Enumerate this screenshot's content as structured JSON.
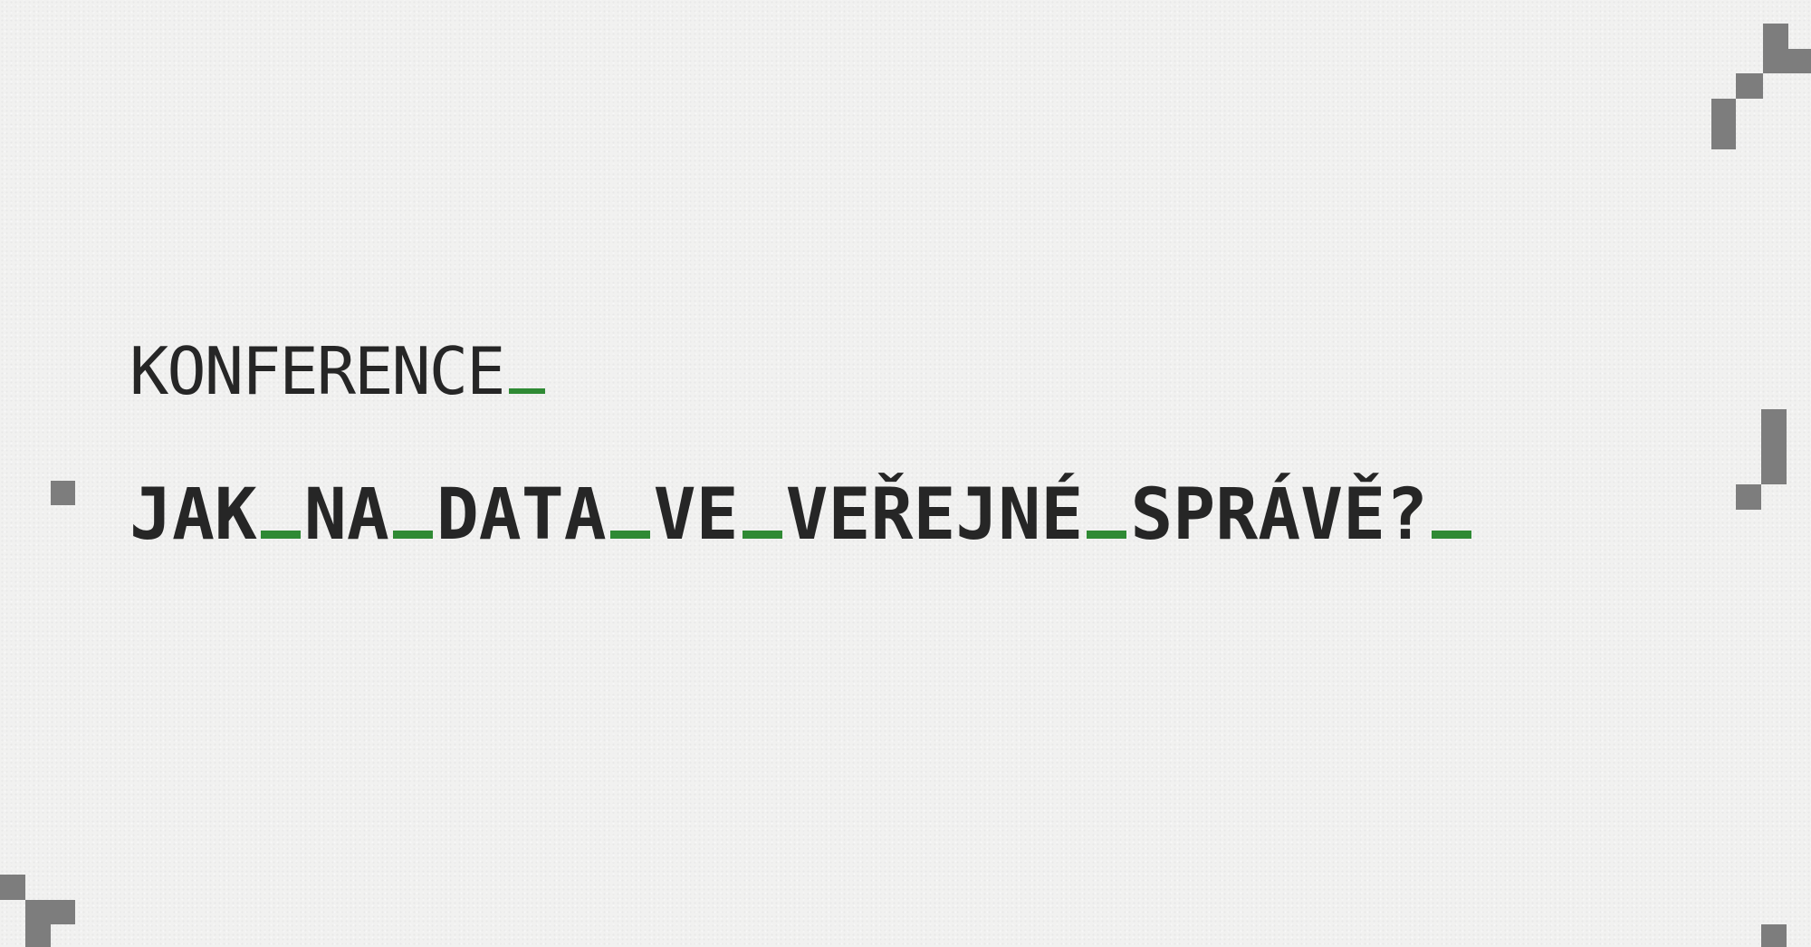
{
  "eyebrow": {
    "text": "KONFERENCE"
  },
  "headline": {
    "words": [
      "JAK",
      "NA",
      "DATA",
      "VE",
      "VEŘEJNÉ",
      "SPRÁVĚ?"
    ]
  },
  "colors": {
    "background": "#f1f1f0",
    "text": "#262626",
    "accent": "#2f8a34",
    "pixel": "#7d7d7d"
  },
  "icons": [
    "pixel-decoration"
  ]
}
